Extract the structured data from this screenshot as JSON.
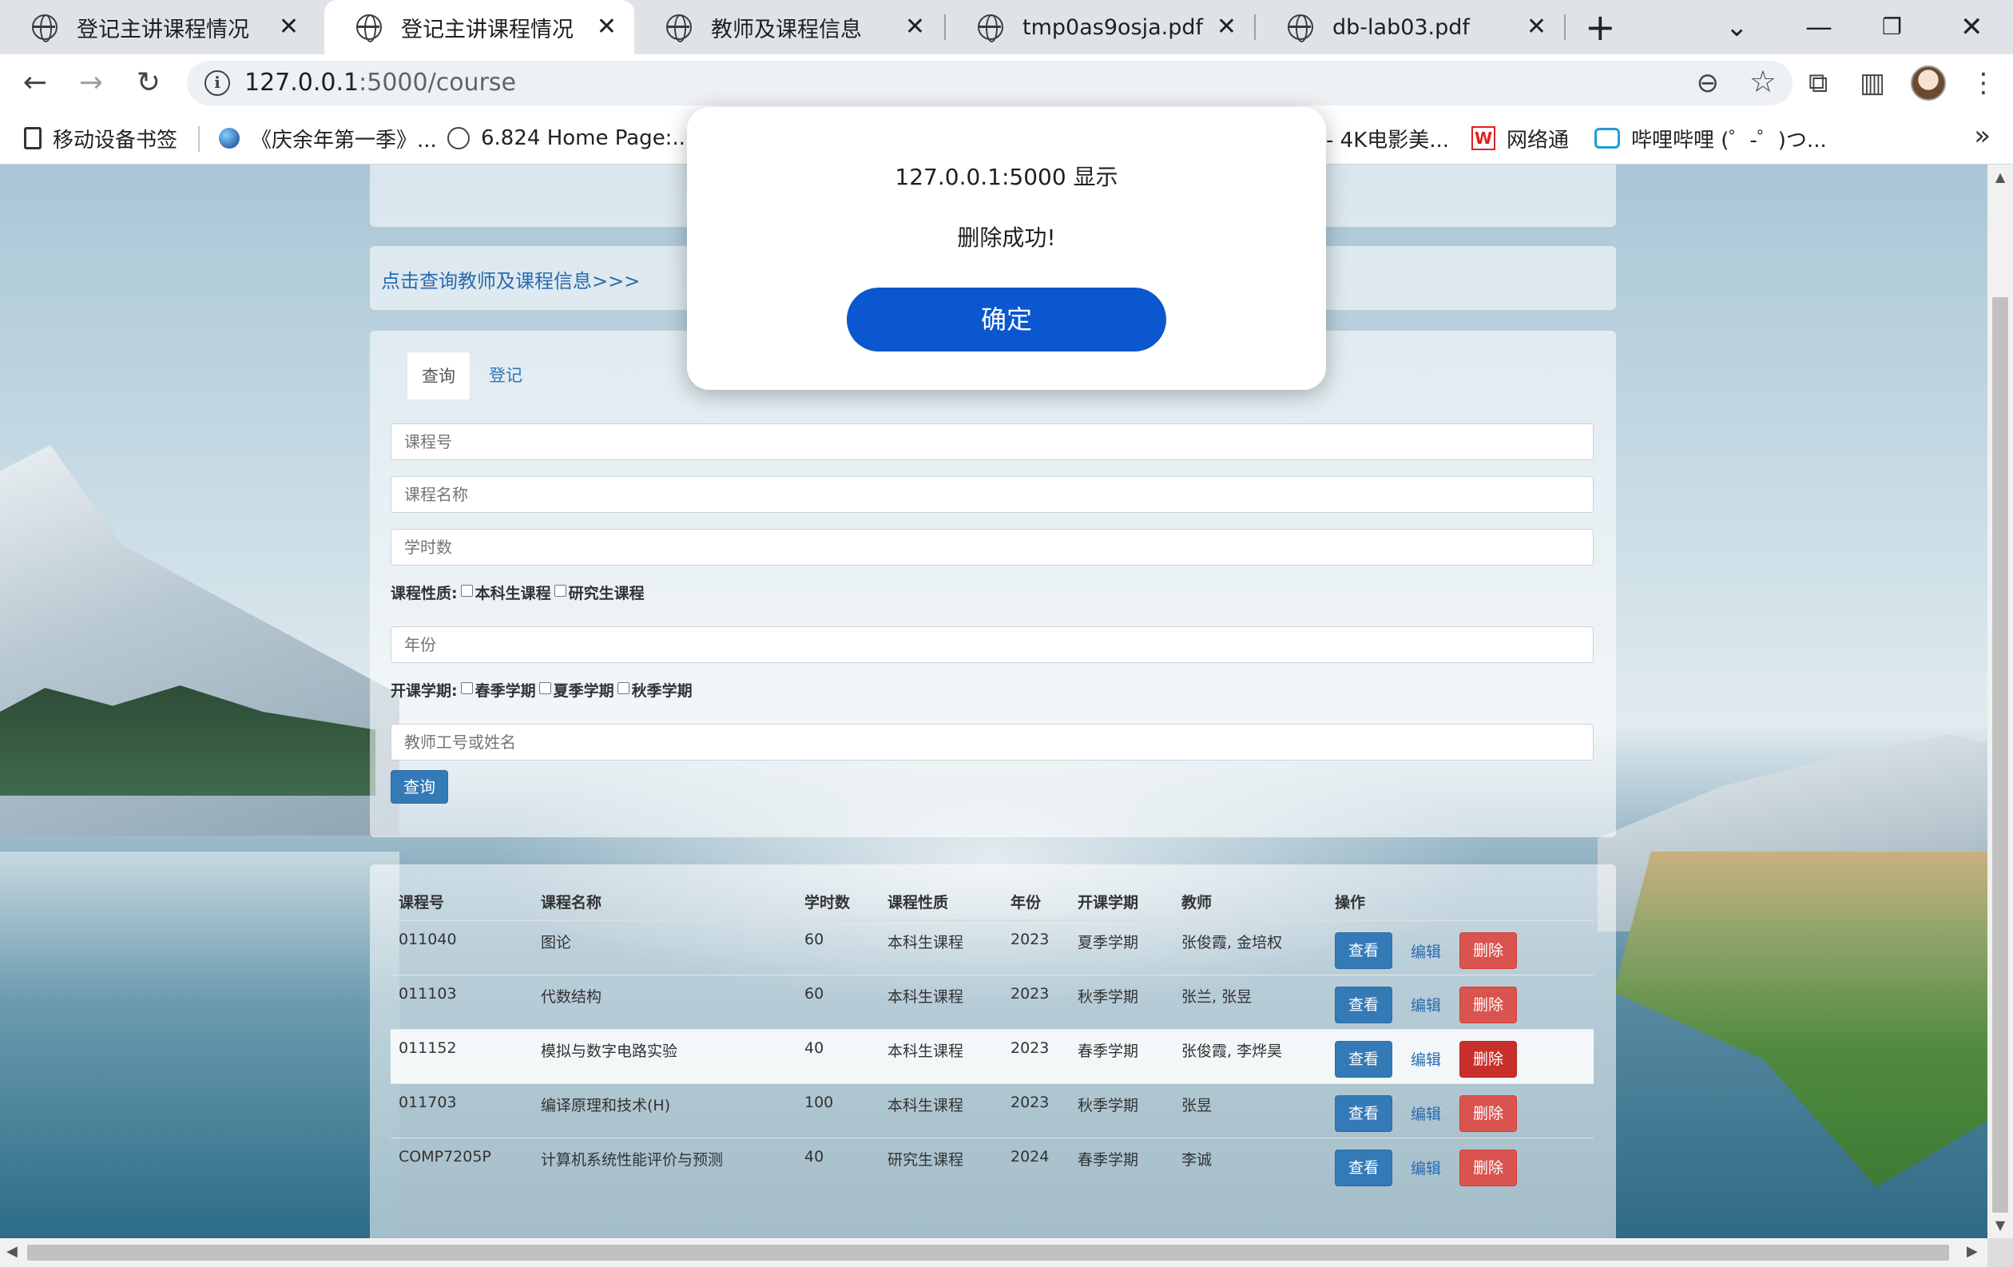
{
  "browser": {
    "tabs": [
      {
        "title": "登记主讲课程情况",
        "active": false
      },
      {
        "title": "登记主讲课程情况",
        "active": true
      },
      {
        "title": "教师及课程信息",
        "active": false
      },
      {
        "title": "tmp0as9osja.pdf",
        "active": false
      },
      {
        "title": "db-lab03.pdf",
        "active": false
      }
    ],
    "url_host": "127.0.0.1",
    "url_rest": ":5000/course",
    "bookmarks": [
      {
        "label": "移动设备书签",
        "icon": "bookmark-folder-icon"
      },
      {
        "label": "《庆余年第一季》...",
        "icon": "site-favicon"
      },
      {
        "label": "6.824 Home Page:...",
        "icon": "globe-icon"
      },
      {
        "label": "- 4K电影美...",
        "icon": "site-favicon"
      },
      {
        "label": "网络通",
        "icon": "wang-favicon"
      },
      {
        "label": "哔哩哔哩 (゜-゜)つ...",
        "icon": "bilibili-icon"
      }
    ]
  },
  "page": {
    "link_text": "点击查询教师及课程信息>>>",
    "tabs": [
      "查询",
      "登记"
    ],
    "placeholders": {
      "course_id": "课程号",
      "course_name": "课程名称",
      "hours": "学时数",
      "year": "年份",
      "teacher": "教师工号或姓名"
    },
    "nature_label": "课程性质:",
    "nature_options": [
      "本科生课程",
      "研究生课程"
    ],
    "semester_label": "开课学期:",
    "semester_options": [
      "春季学期",
      "夏季学期",
      "秋季学期"
    ],
    "query_button": "查询",
    "table": {
      "headers": [
        "课程号",
        "课程名称",
        "学时数",
        "课程性质",
        "年份",
        "开课学期",
        "教师",
        "操作"
      ],
      "rows": [
        [
          "011040",
          "图论",
          "60",
          "本科生课程",
          "2023",
          "夏季学期",
          "张俊霞, 金培权"
        ],
        [
          "011103",
          "代数结构",
          "60",
          "本科生课程",
          "2023",
          "秋季学期",
          "张兰, 张昱"
        ],
        [
          "011152",
          "模拟与数字电路实验",
          "40",
          "本科生课程",
          "2023",
          "春季学期",
          "张俊霞, 李烨昊"
        ],
        [
          "011703",
          "编译原理和技术(H)",
          "100",
          "本科生课程",
          "2023",
          "秋季学期",
          "张昱"
        ],
        [
          "COMP7205P",
          "计算机系统性能评价与预测",
          "40",
          "研究生课程",
          "2024",
          "春季学期",
          "李诚"
        ]
      ],
      "actions": {
        "view": "查看",
        "edit": "编辑",
        "delete": "删除"
      }
    }
  },
  "dialog": {
    "title": "127.0.0.1:5000 显示",
    "message": "删除成功!",
    "ok": "确定"
  },
  "colors": {
    "primary": "#337ab7",
    "danger": "#d9534f",
    "dialog_button": "#0b57d0",
    "link": "#2a6bb0"
  }
}
